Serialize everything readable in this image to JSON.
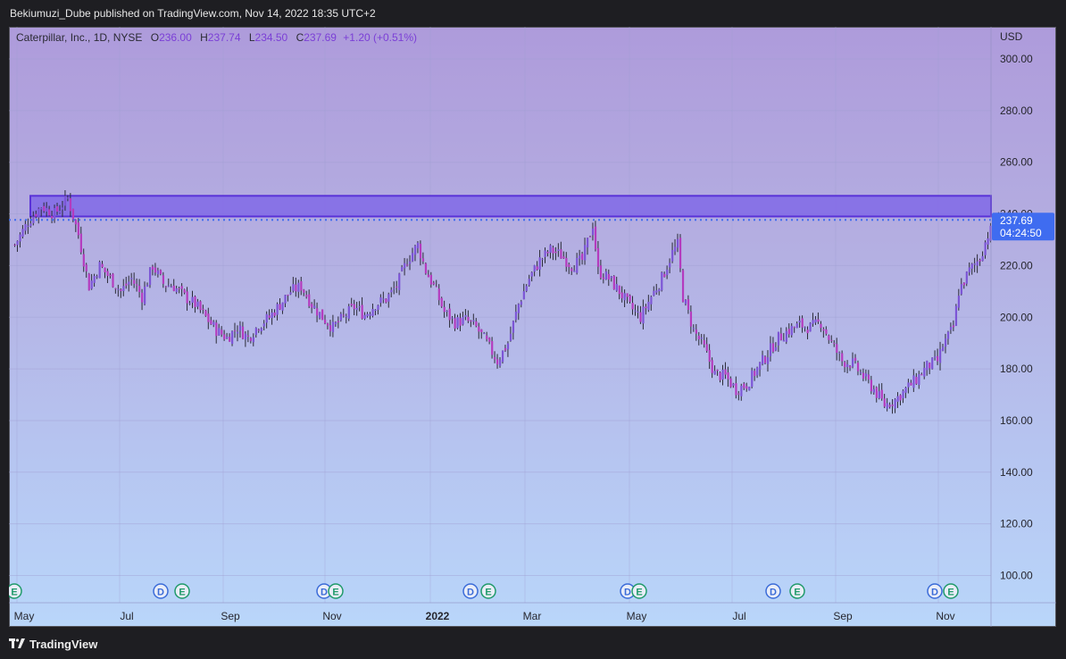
{
  "header": {
    "published": "Bekiumuzi_Dube published on TradingView.com, Nov 14, 2022 18:35 UTC+2"
  },
  "legend": {
    "symbol": "Caterpillar, Inc., 1D, NYSE",
    "o_label": "O",
    "o": "236.00",
    "h_label": "H",
    "h": "237.74",
    "l_label": "L",
    "l": "234.50",
    "c_label": "C",
    "c": "237.69",
    "change": "+1.20 (+0.51%)"
  },
  "price_tag": {
    "price": "237.69",
    "countdown": "04:24:50"
  },
  "footer": {
    "brand": "TradingView"
  },
  "colors": {
    "up_candle": "#7c55d6",
    "down_candle": "#b43bbe",
    "wick": "#2a2a36",
    "zone_fill": "#8068e6",
    "zone_border": "#5a32d8",
    "last_price": "#3f6cf0"
  },
  "chart_data": {
    "type": "candlestick",
    "currency_label": "USD",
    "ylim": [
      92,
      310
    ],
    "y_ticks": [
      "300.00",
      "280.00",
      "260.00",
      "240.00",
      "220.00",
      "200.00",
      "180.00",
      "160.00",
      "140.00",
      "120.00",
      "100.00"
    ],
    "x_ticks": [
      "May",
      "Jul",
      "Sep",
      "Nov",
      "2022",
      "Mar",
      "May",
      "Jul",
      "Sep",
      "Nov"
    ],
    "last_price": 237.69,
    "resistance_zone": {
      "from": 239,
      "to": 247
    },
    "trend_points": [
      [
        0,
        228
      ],
      [
        5,
        237
      ],
      [
        10,
        243
      ],
      [
        15,
        240
      ],
      [
        20,
        246
      ],
      [
        24,
        232
      ],
      [
        28,
        212
      ],
      [
        32,
        220
      ],
      [
        36,
        215
      ],
      [
        40,
        210
      ],
      [
        44,
        215
      ],
      [
        48,
        208
      ],
      [
        52,
        220
      ],
      [
        56,
        213
      ],
      [
        60,
        212
      ],
      [
        64,
        208
      ],
      [
        68,
        205
      ],
      [
        72,
        200
      ],
      [
        76,
        195
      ],
      [
        80,
        192
      ],
      [
        84,
        196
      ],
      [
        88,
        192
      ],
      [
        92,
        197
      ],
      [
        96,
        200
      ],
      [
        100,
        205
      ],
      [
        104,
        210
      ],
      [
        108,
        212
      ],
      [
        112,
        205
      ],
      [
        116,
        200
      ],
      [
        120,
        196
      ],
      [
        124,
        200
      ],
      [
        128,
        204
      ],
      [
        132,
        201
      ],
      [
        136,
        205
      ],
      [
        140,
        207
      ],
      [
        144,
        212
      ],
      [
        148,
        222
      ],
      [
        152,
        228
      ],
      [
        155,
        218
      ],
      [
        158,
        212
      ],
      [
        162,
        202
      ],
      [
        166,
        198
      ],
      [
        170,
        199
      ],
      [
        174,
        196
      ],
      [
        178,
        190
      ],
      [
        182,
        183
      ],
      [
        186,
        190
      ],
      [
        190,
        205
      ],
      [
        194,
        215
      ],
      [
        198,
        222
      ],
      [
        202,
        226
      ],
      [
        206,
        224
      ],
      [
        210,
        220
      ],
      [
        214,
        222
      ],
      [
        218,
        236
      ],
      [
        220,
        218
      ],
      [
        224,
        215
      ],
      [
        228,
        210
      ],
      [
        232,
        204
      ],
      [
        236,
        200
      ],
      [
        240,
        208
      ],
      [
        244,
        215
      ],
      [
        248,
        225
      ],
      [
        250,
        228
      ],
      [
        252,
        208
      ],
      [
        256,
        195
      ],
      [
        260,
        188
      ],
      [
        264,
        178
      ],
      [
        268,
        177
      ],
      [
        272,
        172
      ],
      [
        276,
        174
      ],
      [
        280,
        180
      ],
      [
        284,
        186
      ],
      [
        288,
        192
      ],
      [
        292,
        195
      ],
      [
        296,
        197
      ],
      [
        300,
        196
      ],
      [
        304,
        198
      ],
      [
        308,
        190
      ],
      [
        312,
        183
      ],
      [
        316,
        182
      ],
      [
        320,
        177
      ],
      [
        324,
        172
      ],
      [
        328,
        166
      ],
      [
        332,
        168
      ],
      [
        336,
        172
      ],
      [
        340,
        176
      ],
      [
        344,
        181
      ],
      [
        348,
        183
      ],
      [
        350,
        189
      ],
      [
        354,
        196
      ],
      [
        356,
        210
      ],
      [
        360,
        218
      ],
      [
        364,
        223
      ],
      [
        367,
        232
      ],
      [
        370,
        236
      ],
      [
        372,
        238
      ]
    ],
    "n_bars": 373
  }
}
